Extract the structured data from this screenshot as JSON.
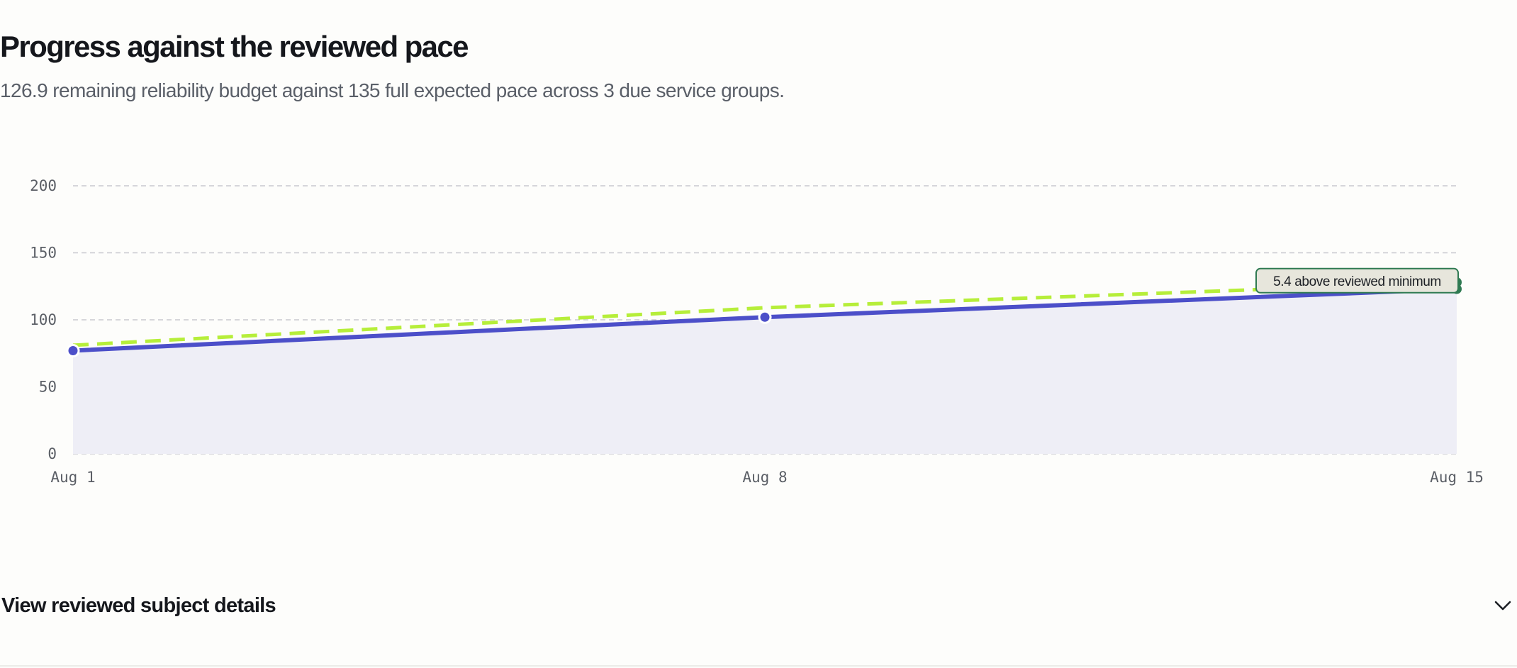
{
  "header": {
    "title": "Progress against the reviewed pace",
    "subtitle": "126.9 remaining reliability budget against 135 full expected pace across 3 due service groups."
  },
  "chart_data": {
    "type": "line",
    "x": [
      "Aug 1",
      "Aug 8",
      "Aug 15"
    ],
    "ylim": [
      0,
      200
    ],
    "yticks": [
      0,
      50,
      100,
      150,
      200
    ],
    "grid": true,
    "series": [
      {
        "style": "solid-with-area",
        "color": "#4c4fc9",
        "values": [
          77,
          102,
          123
        ]
      },
      {
        "style": "dashed",
        "color": "#b6ee3a",
        "values": [
          81,
          109,
          128
        ]
      }
    ],
    "annotation": {
      "text": "5.4 above reviewed minimum",
      "at": "Aug 15"
    }
  },
  "details": {
    "label": "View reviewed subject details",
    "icon": "chevron-down-icon"
  },
  "colors": {
    "actual_line": "#4c4fc9",
    "actual_area": "#eeeef6",
    "pace_line": "#b6ee3a",
    "annotation_border": "#2f7a52",
    "annotation_fill": "#e7e6dc",
    "grid": "#c9cacf"
  }
}
